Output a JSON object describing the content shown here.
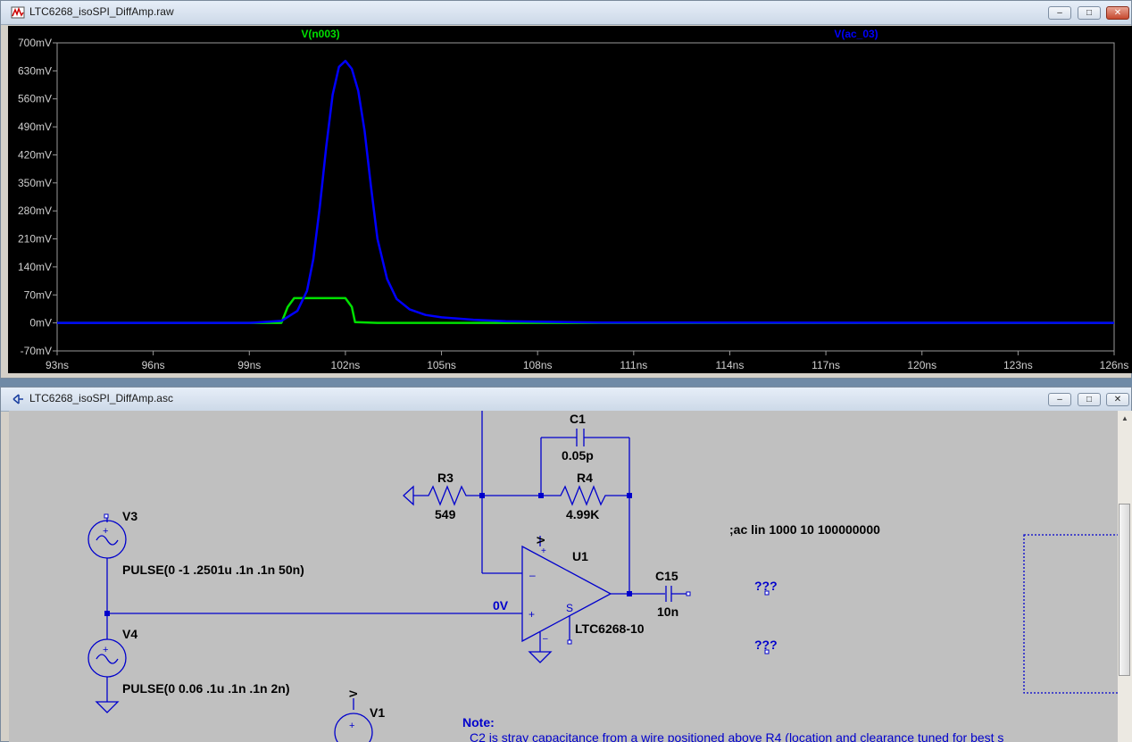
{
  "plot_window": {
    "title": "LTC6268_isoSPI_DiffAmp.raw",
    "controls": {
      "minimize": "–",
      "maximize": "□",
      "close": "✕"
    }
  },
  "schematic_window": {
    "title": "LTC6268_isoSPI_DiffAmp.asc",
    "controls": {
      "minimize": "–",
      "maximize": "□",
      "close": "✕"
    }
  },
  "chart_data": {
    "type": "line",
    "series": [
      {
        "name": "V(n003)",
        "color": "#00e000",
        "x": [
          93,
          100.0,
          100.2,
          100.4,
          102.0,
          102.2,
          102.3,
          103.0,
          110,
          126
        ],
        "y": [
          0,
          0,
          40,
          62,
          62,
          40,
          2,
          0,
          0,
          0
        ]
      },
      {
        "name": "V(ac_03)",
        "color": "#0000ff",
        "x": [
          93,
          99,
          100,
          100.5,
          100.8,
          101.0,
          101.2,
          101.4,
          101.6,
          101.8,
          102.0,
          102.2,
          102.4,
          102.6,
          102.8,
          103.0,
          103.3,
          103.6,
          104.0,
          104.5,
          105.0,
          106.0,
          107.0,
          110,
          126
        ],
        "y": [
          0,
          0,
          5,
          30,
          80,
          160,
          290,
          440,
          570,
          640,
          655,
          635,
          580,
          480,
          340,
          210,
          110,
          60,
          34,
          20,
          14,
          8,
          4,
          1,
          0
        ]
      }
    ],
    "xlabel": "",
    "ylabel": "",
    "x_ticks": [
      "93ns",
      "96ns",
      "99ns",
      "102ns",
      "105ns",
      "108ns",
      "111ns",
      "114ns",
      "117ns",
      "120ns",
      "123ns",
      "126ns"
    ],
    "y_ticks": [
      "700mV",
      "630mV",
      "560mV",
      "490mV",
      "420mV",
      "350mV",
      "280mV",
      "210mV",
      "140mV",
      "70mV",
      "0mV",
      "-70mV"
    ],
    "xlim": [
      93,
      126
    ],
    "ylim": [
      -70,
      700
    ],
    "grid": false,
    "legend": "top"
  },
  "schematic": {
    "components": {
      "c1": {
        "name": "C1",
        "value": "0.05p"
      },
      "r3": {
        "name": "R3",
        "value": "549"
      },
      "r4": {
        "name": "R4",
        "value": "4.99K"
      },
      "u1": {
        "name": "U1",
        "value": "LTC6268-10"
      },
      "c15": {
        "name": "C15",
        "value": "10n"
      },
      "v3": {
        "name": "V3",
        "value": "PULSE(0 -1 .2501u .1n .1n 50n)"
      },
      "v4": {
        "name": "V4",
        "value": "PULSE(0 0.06 .1u .1n .1n 2n)"
      },
      "v1": {
        "name": "V1"
      }
    },
    "net_label_0v": "0V",
    "directive": ";ac lin 1000 10 100000000",
    "unknown_1": "???",
    "unknown_2": "???",
    "note_title": "Note:",
    "note_text": "C2 is stray capacitance from a wire positioned above R4 (location and clearance tuned for best s",
    "pin_labels": {
      "plus": "+",
      "minus": "–",
      "shdn": "S",
      "supply": "V"
    }
  }
}
